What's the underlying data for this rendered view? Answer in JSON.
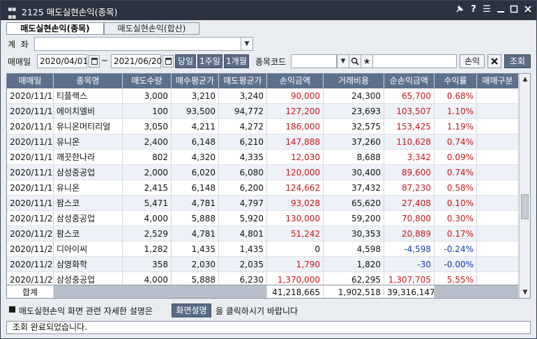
{
  "window": {
    "title": "2125 매도실현손익(종목)",
    "controls": [
      "pin-icon",
      "help-icon",
      "menu-icon",
      "minimize-icon",
      "maximize-icon",
      "close-icon"
    ]
  },
  "tabs": [
    {
      "label": "매도실현손익(종목)",
      "active": true
    },
    {
      "label": "매도실현손익(합산)",
      "active": false
    }
  ],
  "filters": {
    "account_label": "계  좌",
    "account_value": "",
    "period_label": "매매일",
    "date_from": "2020/04/01",
    "tilde": "~",
    "date_to": "2021/06/20",
    "quick_today": "당일",
    "quick_1week": "1주일",
    "quick_1month": "1개월",
    "stock_code_label": "종목코드",
    "stock_code_value": "",
    "stock_name_value": "",
    "pnl_button": "손익",
    "query_button": "조회"
  },
  "table": {
    "columns": [
      "매매일",
      "종목명",
      "매도수량",
      "매수평균가",
      "매도평균가",
      "손익금액",
      "거래비용",
      "순손익금액",
      "수익률",
      "매매구분"
    ],
    "rows": [
      [
        "2020/11/12",
        "티플랙스",
        "3,000",
        "3,210",
        "3,240",
        "90,000",
        "24,300",
        "65,700",
        "0.68%",
        ""
      ],
      [
        "2020/11/16",
        "에이치엘비",
        "100",
        "93,500",
        "94,772",
        "127,200",
        "23,693",
        "103,507",
        "1.10%",
        ""
      ],
      [
        "2020/11/18",
        "유니온머티리얼",
        "3,050",
        "4,211",
        "4,272",
        "186,000",
        "32,575",
        "153,425",
        "1.19%",
        ""
      ],
      [
        "2020/11/18",
        "유니온",
        "2,400",
        "6,148",
        "6,210",
        "147,888",
        "37,260",
        "110,628",
        "0.74%",
        ""
      ],
      [
        "2020/11/18",
        "깨끗한나라",
        "802",
        "4,320",
        "4,335",
        "12,030",
        "8,688",
        "3,342",
        "0.09%",
        ""
      ],
      [
        "2020/11/18",
        "삼성중공업",
        "2,000",
        "6,020",
        "6,080",
        "120,000",
        "30,400",
        "89,600",
        "0.74%",
        ""
      ],
      [
        "2020/11/19",
        "유니온",
        "2,415",
        "6,148",
        "6,200",
        "124,662",
        "37,432",
        "87,230",
        "0.58%",
        ""
      ],
      [
        "2020/11/19",
        "팜스코",
        "5,471",
        "4,781",
        "4,797",
        "93,028",
        "65,620",
        "27,408",
        "0.10%",
        ""
      ],
      [
        "2020/11/20",
        "삼성중공업",
        "4,000",
        "5,888",
        "5,920",
        "130,000",
        "59,200",
        "70,800",
        "0.30%",
        ""
      ],
      [
        "2020/11/20",
        "팜스코",
        "2,529",
        "4,781",
        "4,801",
        "51,242",
        "30,353",
        "20,889",
        "0.17%",
        ""
      ],
      [
        "2020/11/20",
        "디아이씨",
        "1,282",
        "1,435",
        "1,435",
        "0",
        "4,598",
        "-4,598",
        "-0.24%",
        ""
      ],
      [
        "2020/11/23",
        "삼영화학",
        "358",
        "2,030",
        "2,035",
        "1,790",
        "1,820",
        "-30",
        "-0.00%",
        ""
      ],
      [
        "2020/11/23",
        "삼성중공업",
        "4,000",
        "5,888",
        "6,230",
        "1,370,000",
        "62,295",
        "1,307,705",
        "5.55%",
        ""
      ]
    ],
    "summary": {
      "label": "합계",
      "pnl_total": "41,218,665",
      "cost_total": "1,902,518",
      "net_total": "39,316,147"
    },
    "scroll_position": 0.62
  },
  "info": {
    "text_before": "매도실현손익 화면 관련 자세한 설명은",
    "help_button": "화면설명",
    "text_after": "을 클릭하시기 바랍니다"
  },
  "status": {
    "message": "조회 완료되었습니다."
  },
  "colors": {
    "titlebar": "#2c3340",
    "header": "#5d6f8c",
    "positive": "#c8161d",
    "negative": "#1038a8",
    "button": "#5a6b86"
  }
}
